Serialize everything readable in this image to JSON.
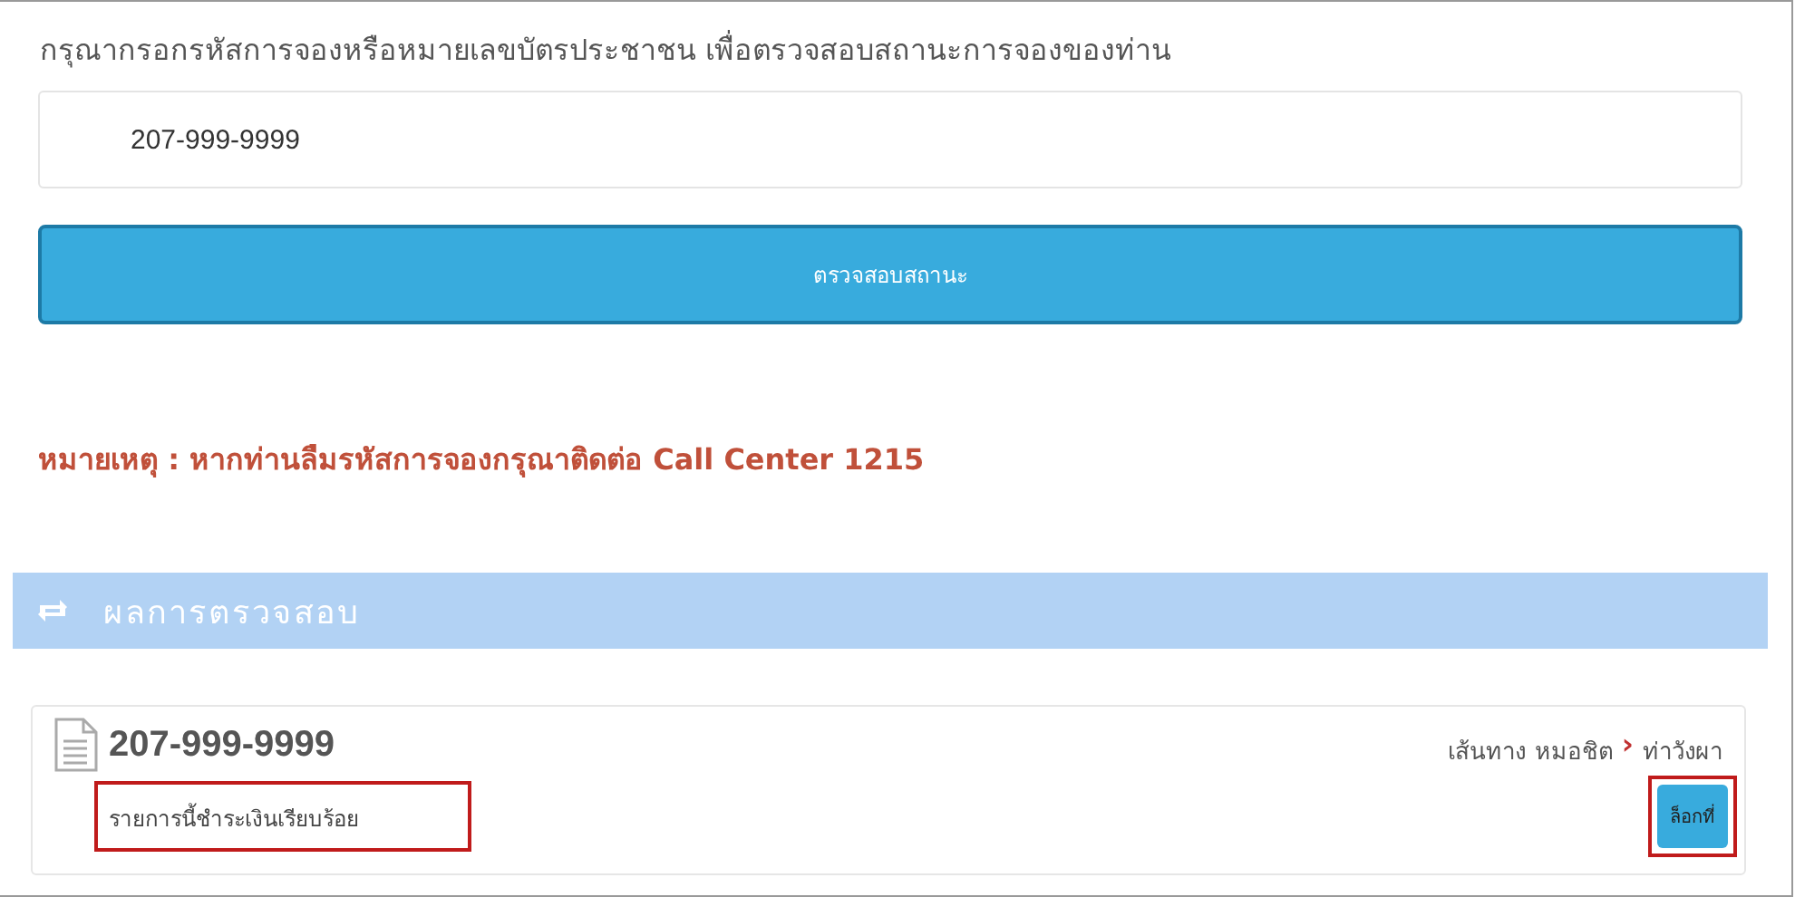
{
  "prompt": "กรุณากรอกรหัสการจองหรือหมายเลขบัตรประชาชน เพื่อตรวจสอบสถานะการจองของท่าน",
  "search": {
    "value": "207-999-9999"
  },
  "check_button": "ตรวจสอบสถานะ",
  "note": "หมายเหตุ : หากท่านลืมรหัสการจองกรุณาติดต่อ Call Center 1215",
  "results_header": "ผลการตรวจสอบ",
  "result": {
    "code": "207-999-9999",
    "route_label": "เส้นทาง",
    "origin": "หมอชิต",
    "separator": "›",
    "destination": "ท่าวังผา",
    "status": "รายการนี้ชำระเงินเรียบร้อย",
    "status_highlighted": true,
    "action": "ล็อกที่",
    "action_highlighted": true
  }
}
